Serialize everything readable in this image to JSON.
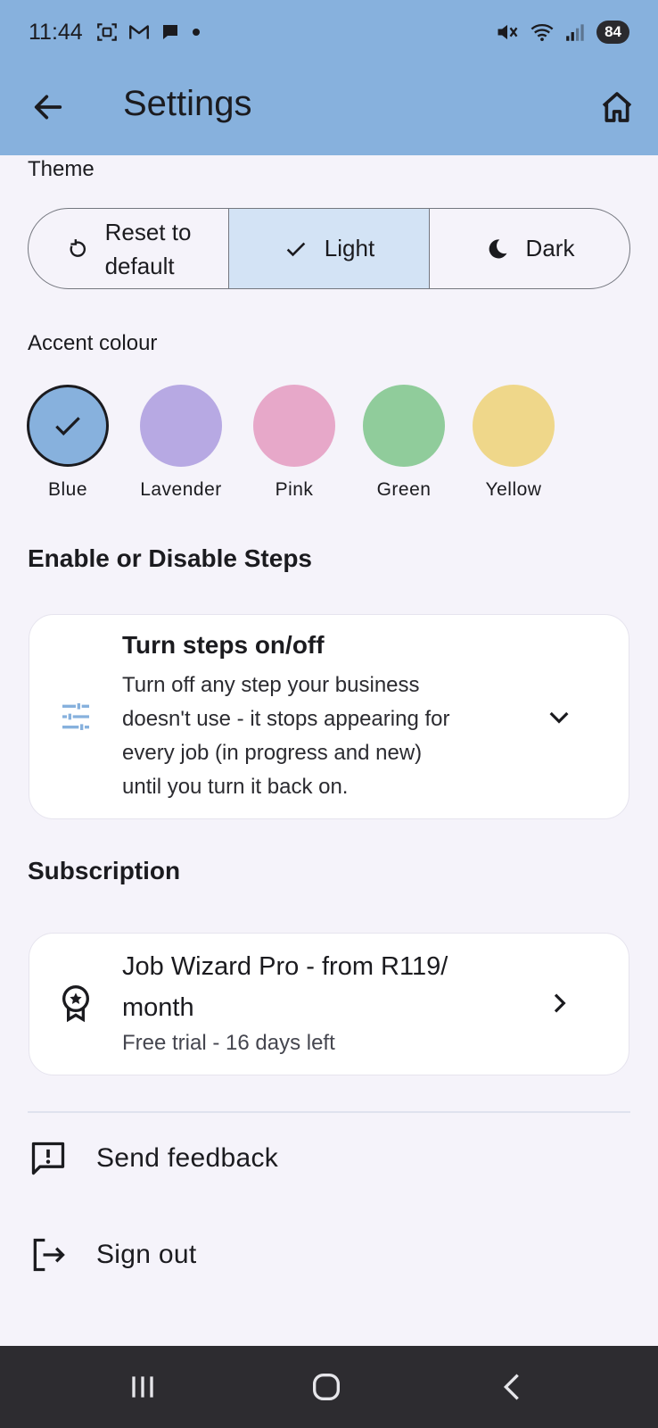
{
  "status_bar": {
    "time": "11:44",
    "battery": "84",
    "icons": [
      "screenshot-icon",
      "gmail-icon",
      "chat-icon",
      "dot-icon",
      "mute-icon",
      "wifi-icon",
      "signal-icon"
    ]
  },
  "app_bar": {
    "title": "Settings",
    "back_icon": "arrow-left-icon",
    "home_icon": "home-icon"
  },
  "theme": {
    "label": "Theme",
    "options": [
      {
        "label_line1": "Reset to",
        "label_line2": "default",
        "icon": "reset-icon",
        "selected": false
      },
      {
        "label": "Light",
        "icon": "check-icon",
        "selected": true
      },
      {
        "label": "Dark",
        "icon": "moon-icon",
        "selected": false
      }
    ]
  },
  "accent": {
    "label": "Accent colour",
    "swatches": [
      {
        "name": "Blue",
        "color": "#87b1dd",
        "selected": true
      },
      {
        "name": "Lavender",
        "color": "#b7a9e3",
        "selected": false
      },
      {
        "name": "Pink",
        "color": "#e7a8c9",
        "selected": false
      },
      {
        "name": "Green",
        "color": "#90cc9b",
        "selected": false
      },
      {
        "name": "Yellow",
        "color": "#efd78a",
        "selected": false
      }
    ]
  },
  "steps": {
    "heading": "Enable or Disable Steps",
    "card_title": "Turn steps on/off",
    "card_body_lines": [
      "Turn off any step your business",
      "doesn't use - it stops appearing for",
      "every job (in progress and new)",
      "until you turn it back on."
    ],
    "icon": "tune-icon"
  },
  "subscription": {
    "heading": "Subscription",
    "title_line1": "Job Wizard Pro - from R119/",
    "title_line2": "month",
    "subtitle": "Free trial - 16 days left",
    "icon": "award-icon"
  },
  "actions": {
    "feedback": "Send feedback",
    "signout": "Sign out"
  },
  "colors": {
    "app_bar": "#87b1dd",
    "selected_segment": "#d3e3f5",
    "background": "#f5f3fa",
    "tune_icon": "#87b1dd"
  }
}
